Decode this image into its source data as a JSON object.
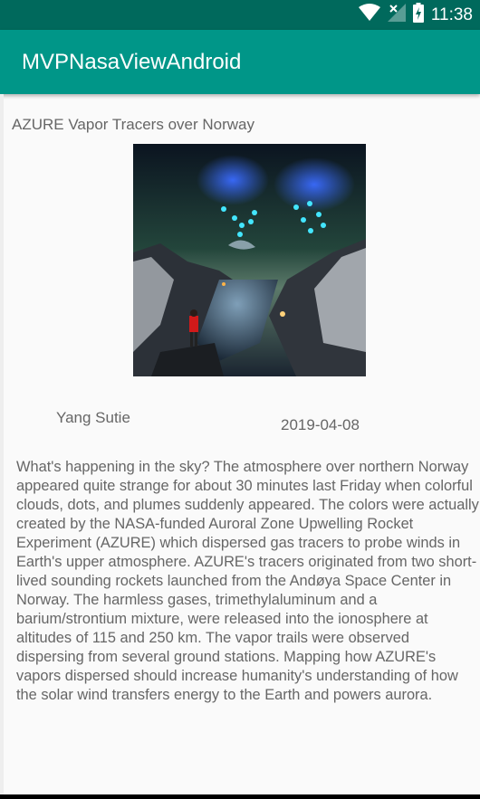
{
  "status_bar": {
    "time": "11:38",
    "icons": [
      "wifi-icon",
      "signal-off-icon",
      "battery-charging-icon"
    ]
  },
  "app_bar": {
    "title": "MVPNasaViewAndroid"
  },
  "apod": {
    "title": "AZURE Vapor Tracers over Norway",
    "image_alt": "AZURE Vapor Tracers over Norway",
    "author": "Yang Sutie",
    "date": "2019-04-08",
    "explanation": "What's happening in the sky? The atmosphere over northern Norway appeared quite strange for about 30 minutes last Friday when colorful clouds, dots, and plumes suddenly appeared. The colors were actually created by the NASA-funded Auroral Zone Upwelling Rocket Experiment (AZURE) which dispersed gas tracers to probe winds in Earth's upper atmosphere. AZURE's tracers originated from two short-lived sounding rockets launched from the Andøya Space Center in Norway. The harmless gases, trimethylaluminum and a barium/strontium mixture, were released into the ionosphere at altitudes of 115 and 250 km.  The vapor trails were observed dispersing from several ground stations. Mapping how AZURE's vapors dispersed should increase humanity's understanding of how the solar wind transfers energy to the Earth and powers aurora."
  },
  "colors": {
    "status_bar": "#00695c",
    "app_bar": "#009688",
    "text": "#666666",
    "background": "#fafafa"
  }
}
